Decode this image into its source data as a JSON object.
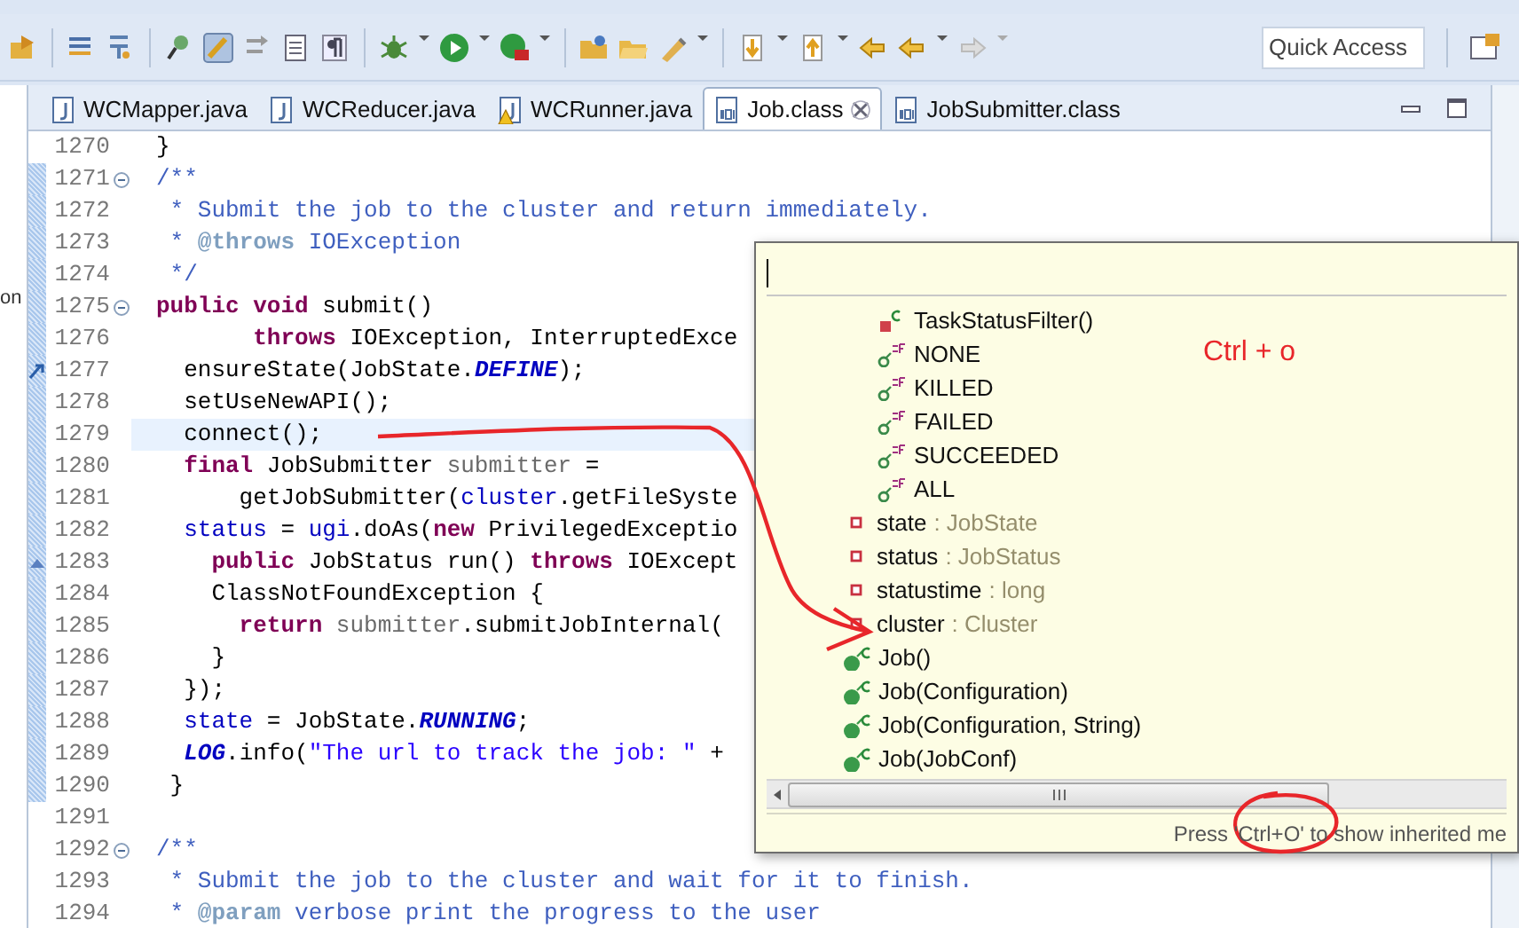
{
  "quick_access": {
    "placeholder": "Quick Access"
  },
  "tabs": [
    {
      "label": "WCMapper.java",
      "kind": "java",
      "warning": false,
      "selected": false
    },
    {
      "label": "WCReducer.java",
      "kind": "java",
      "warning": false,
      "selected": false
    },
    {
      "label": "WCRunner.java",
      "kind": "java",
      "warning": true,
      "selected": false
    },
    {
      "label": "Job.class",
      "kind": "class",
      "warning": false,
      "selected": true
    },
    {
      "label": "JobSubmitter.class",
      "kind": "class",
      "warning": false,
      "selected": false
    }
  ],
  "left_panel_text": "on",
  "code_lines": [
    {
      "number": "1270",
      "changed": false,
      "fold": false,
      "tokens": [
        {
          "text": "}",
          "kind": "plain"
        }
      ]
    },
    {
      "number": "1271",
      "changed": true,
      "fold": true,
      "tokens": [
        {
          "text": "/**",
          "kind": "doc"
        }
      ]
    },
    {
      "number": "1272",
      "changed": true,
      "fold": false,
      "tokens": [
        {
          "text": " * Submit the job to the cluster and return immediately.",
          "kind": "doc"
        }
      ]
    },
    {
      "number": "1273",
      "changed": true,
      "fold": false,
      "tokens": [
        {
          "text": " *",
          "kind": "doc"
        },
        {
          "text": " @throws",
          "kind": "doctag"
        },
        {
          "text": " IOException",
          "kind": "doc"
        }
      ]
    },
    {
      "number": "1274",
      "changed": true,
      "fold": false,
      "tokens": [
        {
          "text": " */",
          "kind": "doc"
        }
      ]
    },
    {
      "number": "1275",
      "changed": true,
      "fold": true,
      "tokens": [
        {
          "text": "public",
          "kind": "kw"
        },
        {
          "text": " void",
          "kind": "kw"
        },
        {
          "text": " submit()",
          "kind": "plain"
        }
      ]
    },
    {
      "number": "1276",
      "changed": true,
      "fold": false,
      "tokens": [
        {
          "text": "       throws",
          "kind": "kw"
        },
        {
          "text": " IOException, InterruptedExce",
          "kind": "plain"
        }
      ]
    },
    {
      "number": "1277",
      "changed": true,
      "fold": false,
      "gutter_marker": {
        "kind": "arrow"
      },
      "tokens": [
        {
          "text": "  ensureState(JobState.",
          "kind": "plain"
        },
        {
          "text": "DEFINE",
          "kind": "static"
        },
        {
          "text": ");",
          "kind": "plain"
        }
      ]
    },
    {
      "number": "1278",
      "changed": true,
      "fold": false,
      "tokens": [
        {
          "text": "  setUseNewAPI();",
          "kind": "plain"
        }
      ]
    },
    {
      "number": "1279",
      "changed": true,
      "fold": false,
      "current": true,
      "tokens": [
        {
          "text": "  connect();",
          "kind": "plain"
        }
      ]
    },
    {
      "number": "1280",
      "changed": true,
      "fold": false,
      "tokens": [
        {
          "text": "  final",
          "kind": "kw"
        },
        {
          "text": " JobSubmitter",
          "kind": "plain"
        },
        {
          "text": " submitter",
          "kind": "local"
        },
        {
          "text": " =",
          "kind": "plain"
        }
      ]
    },
    {
      "number": "1281",
      "changed": true,
      "fold": false,
      "tokens": [
        {
          "text": "      getJobSubmitter(",
          "kind": "plain"
        },
        {
          "text": "cluster",
          "kind": "field"
        },
        {
          "text": ".getFileSyste",
          "kind": "plain"
        }
      ]
    },
    {
      "number": "1282",
      "changed": true,
      "fold": false,
      "tokens": [
        {
          "text": "  status",
          "kind": "field"
        },
        {
          "text": " =",
          "kind": "plain"
        },
        {
          "text": " ugi",
          "kind": "field"
        },
        {
          "text": ".doAs(",
          "kind": "plain"
        },
        {
          "text": "new",
          "kind": "kw"
        },
        {
          "text": " PrivilegedExceptio",
          "kind": "plain"
        }
      ]
    },
    {
      "number": "1283",
      "changed": true,
      "fold": false,
      "gutter_marker": {
        "kind": "triangle"
      },
      "tokens": [
        {
          "text": "    public",
          "kind": "kw"
        },
        {
          "text": " JobStatus run()",
          "kind": "plain"
        },
        {
          "text": " throws",
          "kind": "kw"
        },
        {
          "text": " IOExcept",
          "kind": "plain"
        }
      ]
    },
    {
      "number": "1284",
      "changed": true,
      "fold": false,
      "tokens": [
        {
          "text": "    ClassNotFoundException {",
          "kind": "plain"
        }
      ]
    },
    {
      "number": "1285",
      "changed": true,
      "fold": false,
      "tokens": [
        {
          "text": "      return",
          "kind": "kw"
        },
        {
          "text": " submitter",
          "kind": "local"
        },
        {
          "text": ".submitJobInternal(",
          "kind": "plain"
        }
      ]
    },
    {
      "number": "1286",
      "changed": true,
      "fold": false,
      "tokens": [
        {
          "text": "    }",
          "kind": "plain"
        }
      ]
    },
    {
      "number": "1287",
      "changed": true,
      "fold": false,
      "tokens": [
        {
          "text": "  });",
          "kind": "plain"
        }
      ]
    },
    {
      "number": "1288",
      "changed": true,
      "fold": false,
      "tokens": [
        {
          "text": "  state",
          "kind": "field"
        },
        {
          "text": " = JobState.",
          "kind": "plain"
        },
        {
          "text": "RUNNING",
          "kind": "static"
        },
        {
          "text": ";",
          "kind": "plain"
        }
      ]
    },
    {
      "number": "1289",
      "changed": true,
      "fold": false,
      "tokens": [
        {
          "text": "  LOG",
          "kind": "static"
        },
        {
          "text": ".info(",
          "kind": "plain"
        },
        {
          "text": "\"The url to track the job: \"",
          "kind": "str"
        },
        {
          "text": " +",
          "kind": "plain"
        }
      ]
    },
    {
      "number": "1290",
      "changed": true,
      "fold": false,
      "tokens": [
        {
          "text": " }",
          "kind": "plain"
        }
      ]
    },
    {
      "number": "1291",
      "changed": false,
      "fold": false
    },
    {
      "number": "1292",
      "changed": false,
      "fold": true,
      "tokens": [
        {
          "text": "/**",
          "kind": "doc"
        }
      ]
    },
    {
      "number": "1293",
      "changed": false,
      "fold": false,
      "tokens": [
        {
          "text": " * Submit the job to the cluster and wait for it to finish.",
          "kind": "doc"
        }
      ]
    },
    {
      "number": "1294",
      "changed": false,
      "fold": false,
      "tokens": [
        {
          "text": " *",
          "kind": "doc"
        },
        {
          "text": " @param",
          "kind": "doctag"
        },
        {
          "text": " verbose print the progress to the user",
          "kind": "doc"
        }
      ]
    }
  ],
  "outline_popup": {
    "items": [
      {
        "children": [
          {
            "label": "TaskStatusFilter()",
            "kind": "private-constructor"
          },
          {
            "label": "NONE",
            "kind": "constant"
          },
          {
            "label": "KILLED",
            "kind": "constant"
          },
          {
            "label": "FAILED",
            "kind": "constant"
          },
          {
            "label": "SUCCEEDED",
            "kind": "constant"
          },
          {
            "label": "ALL",
            "kind": "constant"
          }
        ]
      },
      {
        "label": "state",
        "type": ": JobState",
        "kind": "private-field"
      },
      {
        "label": "status",
        "type": ": JobStatus",
        "kind": "private-field"
      },
      {
        "label": "statustime",
        "type": ": long",
        "kind": "private-field"
      },
      {
        "label": "cluster",
        "type": ": Cluster",
        "kind": "private-field"
      },
      {
        "label": "Job()",
        "kind": "constructor"
      },
      {
        "label": "Job(Configuration)",
        "kind": "constructor"
      },
      {
        "label": "Job(Configuration, String)",
        "kind": "constructor"
      },
      {
        "label": "Job(JobConf)",
        "kind": "constructor"
      }
    ],
    "footer": "Press 'Ctrl+O' to show inherited me"
  },
  "annotation": {
    "text": "Ctrl + o"
  }
}
